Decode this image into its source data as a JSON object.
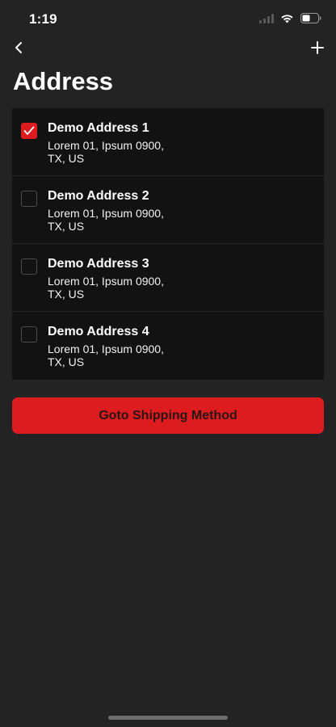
{
  "status_bar": {
    "time": "1:19"
  },
  "nav": {
    "back_icon": "chevron-left-icon",
    "add_icon": "plus-icon"
  },
  "page": {
    "title": "Address"
  },
  "addresses": [
    {
      "name": "Demo Address 1",
      "line1": "Lorem 01, Ipsum 0900,",
      "line2": "TX, US",
      "selected": true
    },
    {
      "name": "Demo Address 2",
      "line1": "Lorem 01, Ipsum 0900,",
      "line2": "TX, US",
      "selected": false
    },
    {
      "name": "Demo Address 3",
      "line1": "Lorem 01, Ipsum 0900,",
      "line2": "TX, US",
      "selected": false
    },
    {
      "name": "Demo Address 4",
      "line1": "Lorem 01, Ipsum 0900,",
      "line2": "TX, US",
      "selected": false
    }
  ],
  "actions": {
    "primary_label": "Goto Shipping Method"
  },
  "colors": {
    "background": "#232323",
    "card": "#121212",
    "accent": "#dc1c1f",
    "text": "#ffffff"
  }
}
